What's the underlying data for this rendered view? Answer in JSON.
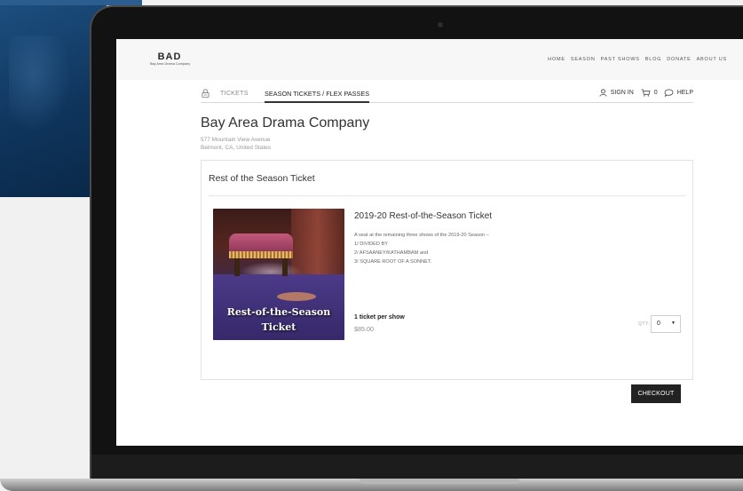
{
  "site": {
    "logo_mark": "BAD",
    "logo_sub": "Bay Area Drama Company",
    "nav": [
      "HOME",
      "SEASON",
      "PAST SHOWS",
      "BLOG",
      "DONATE",
      "ABOUT US"
    ]
  },
  "ticket_bar": {
    "tabs": [
      {
        "label": "TICKETS",
        "active": false
      },
      {
        "label": "SEASON TICKETS / FLEX PASSES",
        "active": true
      }
    ],
    "sign_in": "SIGN IN",
    "cart_count": "0",
    "help": "HELP",
    "icons": [
      "lock-icon",
      "user-icon",
      "cart-icon",
      "chat-icon"
    ]
  },
  "company": {
    "name": "Bay Area Drama Company",
    "address_line1": "577 Mountain View Avenue",
    "address_line2": "Belmont, CA, United States"
  },
  "card": {
    "title": "Rest of the Season Ticket",
    "product": {
      "image_caption_line1": "Rest-of-the-Season",
      "image_caption_line2": "Ticket",
      "title": "2019-20 Rest-of-the-Season Ticket",
      "description": [
        "A seat at the remaining three shows of the 2019-20 Season –",
        "1/ DIVIDED BY",
        "2/ AFSAANEY/KATHAMBAM and",
        "3/ SQUARE ROOT OF A SONNET."
      ],
      "per_show": "1 ticket per show",
      "price": "$85.00",
      "qty_label": "QTY:",
      "qty_value": "0"
    },
    "checkout_label": "CHECKOUT"
  },
  "colors": {
    "button_bg": "#222222",
    "header_bg": "#f7f7f7",
    "backdrop_blue": "#0f355d"
  }
}
